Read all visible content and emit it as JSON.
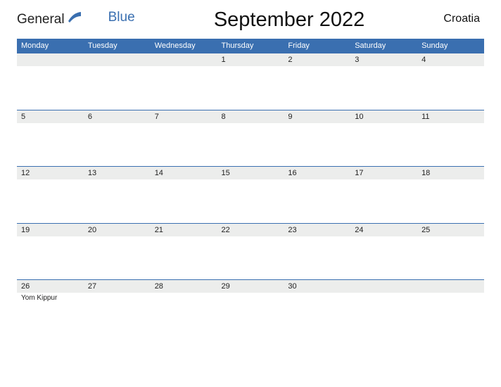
{
  "brand": {
    "text1": "General",
    "text2": "Blue"
  },
  "title": "September 2022",
  "region": "Croatia",
  "day_headers": [
    "Monday",
    "Tuesday",
    "Wednesday",
    "Thursday",
    "Friday",
    "Saturday",
    "Sunday"
  ],
  "weeks": [
    {
      "dates": [
        "",
        "",
        "",
        "1",
        "2",
        "3",
        "4"
      ],
      "events": [
        "",
        "",
        "",
        "",
        "",
        "",
        ""
      ]
    },
    {
      "dates": [
        "5",
        "6",
        "7",
        "8",
        "9",
        "10",
        "11"
      ],
      "events": [
        "",
        "",
        "",
        "",
        "",
        "",
        ""
      ]
    },
    {
      "dates": [
        "12",
        "13",
        "14",
        "15",
        "16",
        "17",
        "18"
      ],
      "events": [
        "",
        "",
        "",
        "",
        "",
        "",
        ""
      ]
    },
    {
      "dates": [
        "19",
        "20",
        "21",
        "22",
        "23",
        "24",
        "25"
      ],
      "events": [
        "",
        "",
        "",
        "",
        "",
        "",
        ""
      ]
    },
    {
      "dates": [
        "26",
        "27",
        "28",
        "29",
        "30",
        "",
        ""
      ],
      "events": [
        "Yom Kippur",
        "",
        "",
        "",
        "",
        "",
        ""
      ]
    }
  ]
}
